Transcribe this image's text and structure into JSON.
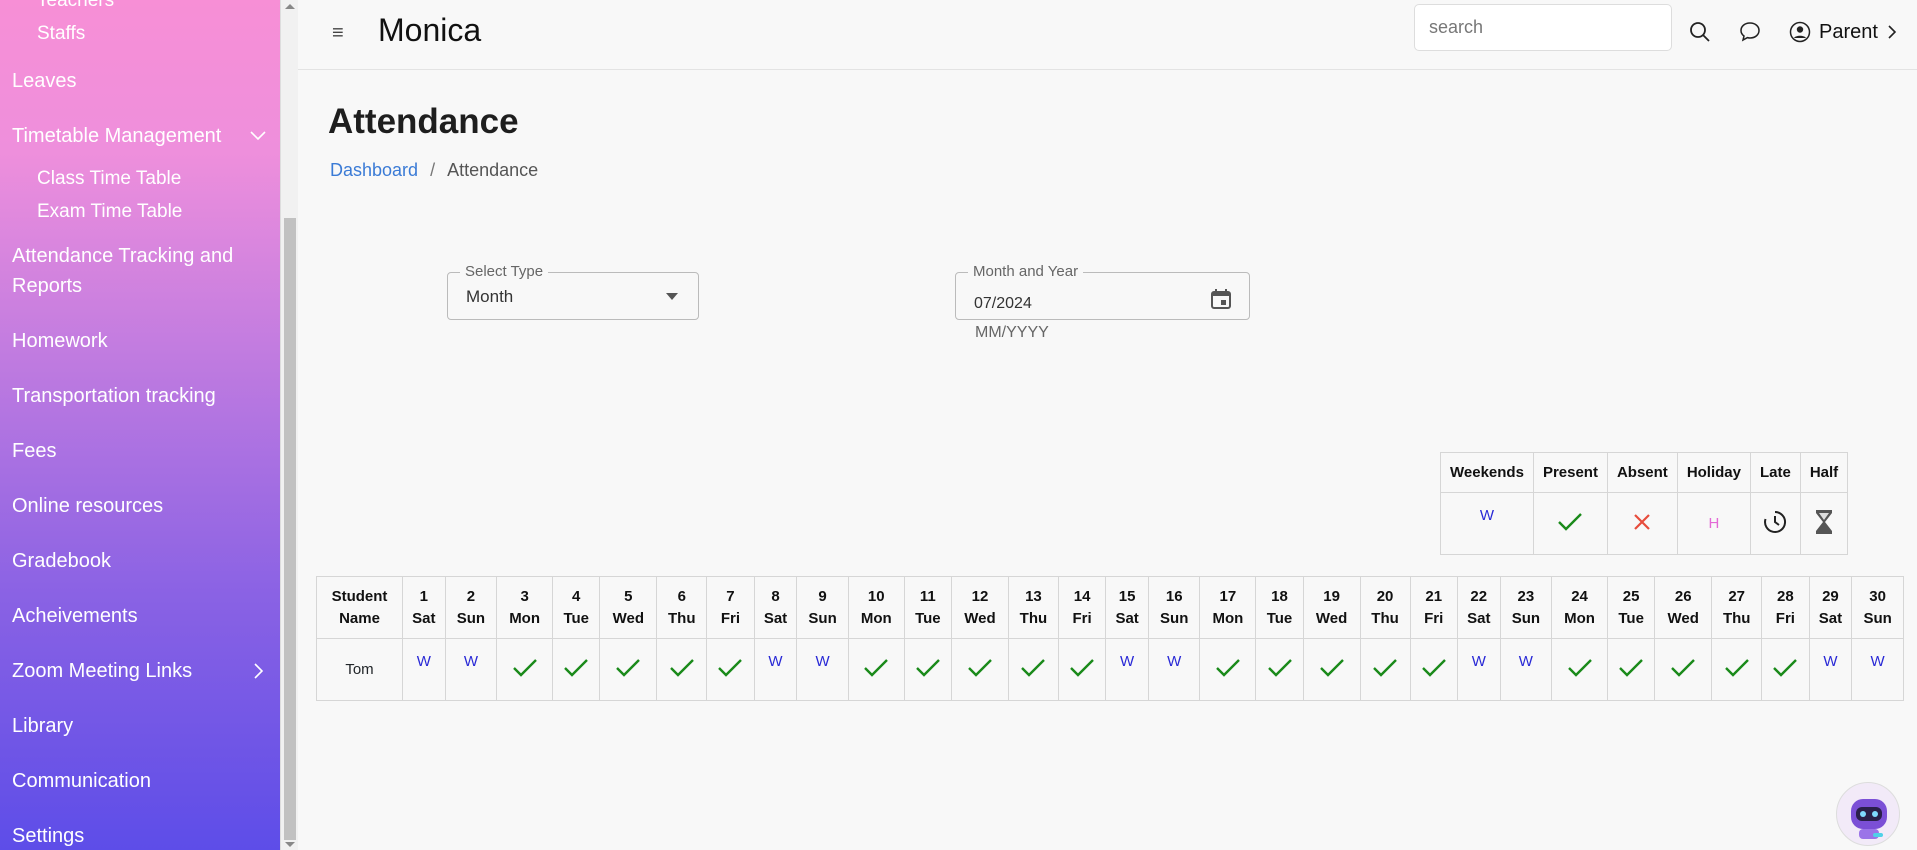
{
  "sidebar": {
    "items": {
      "teachers": "Teachers",
      "staffs": "Staffs",
      "leaves": "Leaves",
      "timetable": "Timetable Management",
      "class_tt": "Class Time Table",
      "exam_tt": "Exam Time Table",
      "attendance_l1": "Attendance Tracking and",
      "attendance_l2": "Reports",
      "homework": "Homework",
      "transport": "Transportation tracking",
      "fees": "Fees",
      "online": "Online resources",
      "gradebook": "Gradebook",
      "achievements": "Acheivements",
      "zoom": "Zoom Meeting Links",
      "library": "Library",
      "communication": "Communication",
      "settings": "Settings"
    }
  },
  "header": {
    "brand": "Monica",
    "search_placeholder": "search",
    "user_label": "Parent"
  },
  "page": {
    "title": "Attendance",
    "breadcrumb_home": "Dashboard",
    "breadcrumb_sep": "/",
    "breadcrumb_current": "Attendance"
  },
  "filters": {
    "type_label": "Select Type",
    "type_value": "Month",
    "date_label": "Month and Year",
    "date_value": "07/2024",
    "date_helper": "MM/YYYY"
  },
  "legend": {
    "headers": [
      "Weekends",
      "Present",
      "Absent",
      "Holiday",
      "Late",
      "Half"
    ],
    "weekend_symbol": "W",
    "holiday_symbol": "H"
  },
  "attendance": {
    "student_header_l1": "Student",
    "student_header_l2": "Name",
    "days": [
      {
        "d": "1",
        "w": "Sat",
        "s": "W"
      },
      {
        "d": "2",
        "w": "Sun",
        "s": "W"
      },
      {
        "d": "3",
        "w": "Mon",
        "s": "P"
      },
      {
        "d": "4",
        "w": "Tue",
        "s": "P"
      },
      {
        "d": "5",
        "w": "Wed",
        "s": "P"
      },
      {
        "d": "6",
        "w": "Thu",
        "s": "P"
      },
      {
        "d": "7",
        "w": "Fri",
        "s": "P"
      },
      {
        "d": "8",
        "w": "Sat",
        "s": "W"
      },
      {
        "d": "9",
        "w": "Sun",
        "s": "W"
      },
      {
        "d": "10",
        "w": "Mon",
        "s": "P"
      },
      {
        "d": "11",
        "w": "Tue",
        "s": "P"
      },
      {
        "d": "12",
        "w": "Wed",
        "s": "P"
      },
      {
        "d": "13",
        "w": "Thu",
        "s": "P"
      },
      {
        "d": "14",
        "w": "Fri",
        "s": "P"
      },
      {
        "d": "15",
        "w": "Sat",
        "s": "W"
      },
      {
        "d": "16",
        "w": "Sun",
        "s": "W"
      },
      {
        "d": "17",
        "w": "Mon",
        "s": "P"
      },
      {
        "d": "18",
        "w": "Tue",
        "s": "P"
      },
      {
        "d": "19",
        "w": "Wed",
        "s": "P"
      },
      {
        "d": "20",
        "w": "Thu",
        "s": "P"
      },
      {
        "d": "21",
        "w": "Fri",
        "s": "P"
      },
      {
        "d": "22",
        "w": "Sat",
        "s": "W"
      },
      {
        "d": "23",
        "w": "Sun",
        "s": "W"
      },
      {
        "d": "24",
        "w": "Mon",
        "s": "P"
      },
      {
        "d": "25",
        "w": "Tue",
        "s": "P"
      },
      {
        "d": "26",
        "w": "Wed",
        "s": "P"
      },
      {
        "d": "27",
        "w": "Thu",
        "s": "P"
      },
      {
        "d": "28",
        "w": "Fri",
        "s": "P"
      },
      {
        "d": "29",
        "w": "Sat",
        "s": "W"
      },
      {
        "d": "30",
        "w": "Sun",
        "s": "W"
      }
    ],
    "students": [
      {
        "name": "Tom"
      }
    ]
  },
  "colors": {
    "present": "#1a8a1a",
    "absent": "#e74c3c",
    "weekend": "#2929d6",
    "holiday": "#e36ad6",
    "link": "#3b7bd6"
  }
}
